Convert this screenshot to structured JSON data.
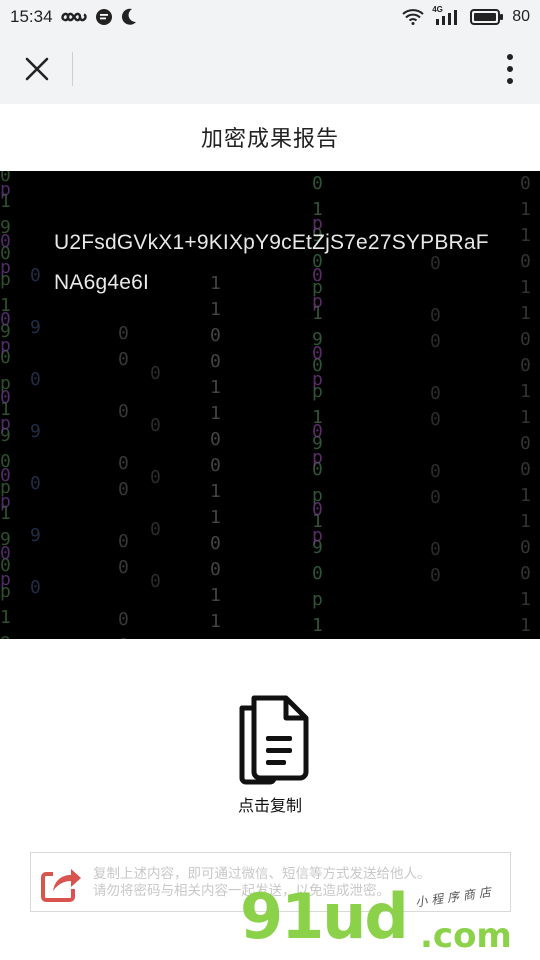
{
  "status_bar": {
    "time": "15:34",
    "left_icons": [
      "infinity-icon",
      "chat-icon",
      "moon-icon"
    ],
    "network_label": "4G",
    "battery": "80"
  },
  "nav": {
    "close_icon": "close-icon",
    "more_icon": "more-vertical-icon"
  },
  "page": {
    "title": "加密成果报告"
  },
  "result": {
    "cipher_text": "U2FsdGVkX1+9KIXpY9cEtZjS7e27SYPBRaFNA6g4e6I"
  },
  "copy": {
    "icon": "copy-document-icon",
    "label": "点击复制"
  },
  "notice": {
    "icon": "share-icon",
    "line1": "复制上述内容，即可通过微信、短信等方式发送给他人。",
    "line2": "请勿将密码与相关内容一起发送，以免造成泄密。"
  },
  "watermark": {
    "big": "91ud",
    "com": ".com",
    "small": "小程序商店"
  },
  "colors": {
    "nav_bg": "#f2f3f5",
    "panel_bg": "#000000",
    "cipher_text": "#e8e8e8",
    "watermark": "#8bd24a"
  }
}
